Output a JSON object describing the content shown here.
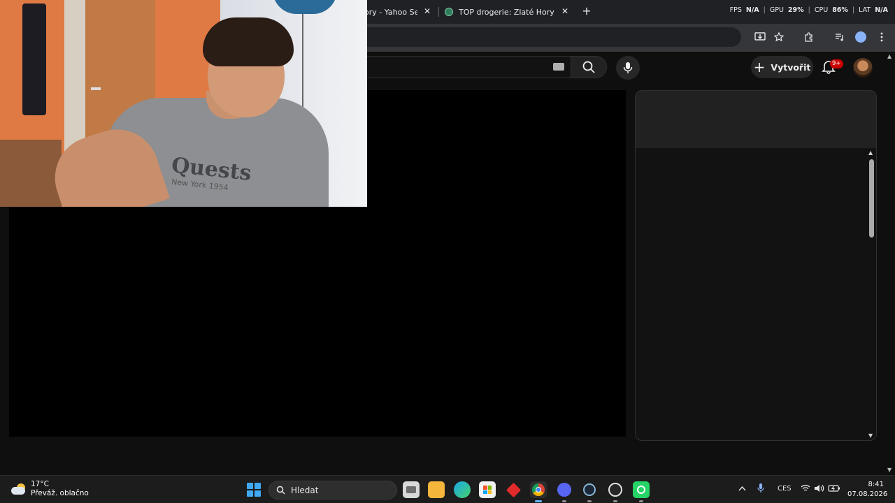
{
  "browser": {
    "tabs": [
      {
        "title": "ory - Yahoo Sear",
        "close": "✕"
      },
      {
        "title": "TOP drogerie: Zlaté Hory",
        "close": "✕"
      }
    ],
    "new_tab": "+",
    "perf_overlay": {
      "fps_label": "FPS",
      "fps_value": "N/A",
      "gpu_label": "GPU",
      "gpu_value": "29%",
      "cpu_label": "CPU",
      "cpu_value": "86%",
      "lat_label": "LAT",
      "lat_value": "N/A",
      "sep": "|"
    }
  },
  "youtube": {
    "create_label": "Vytvořit",
    "notification_badge": "9+"
  },
  "webcam": {
    "shirt_text": "Quests",
    "shirt_subtext": "New York 1954"
  },
  "taskbar": {
    "weather": {
      "temp": "17°C",
      "condition": "Převáž. oblačno"
    },
    "search_label": "Hledat",
    "language": "CES",
    "time": "8:41",
    "date": "07.08.2026"
  },
  "colors": {
    "background": "#0f0f0f",
    "tabstrip": "#202124",
    "toolbar": "#35363a",
    "yt_badge": "#cc0000",
    "taskbar": "#1c1c1c"
  }
}
